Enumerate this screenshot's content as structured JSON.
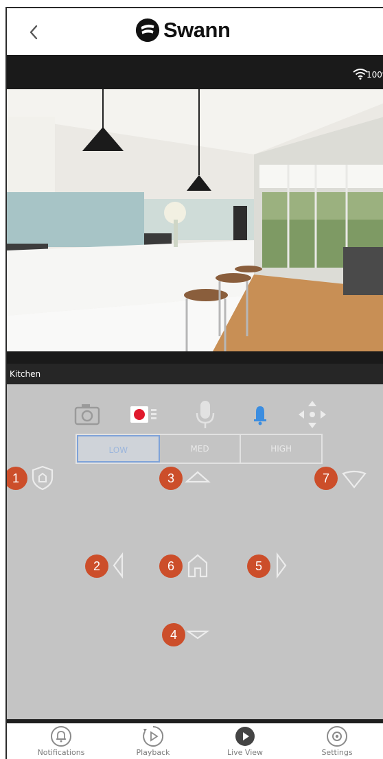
{
  "header": {
    "brand": "Swann",
    "back_icon": "chevron-left-icon"
  },
  "status": {
    "wifi_icon": "wifi-icon",
    "battery": "100%"
  },
  "camera": {
    "name": "Kitchen"
  },
  "tools": [
    {
      "name": "snapshot",
      "icon": "camera-icon"
    },
    {
      "name": "record",
      "icon": "record-icon",
      "color": "#e0192c"
    },
    {
      "name": "talk",
      "icon": "microphone-icon"
    },
    {
      "name": "siren",
      "icon": "bell-icon",
      "color": "#3b8de0"
    },
    {
      "name": "ptz",
      "icon": "move-arrows-icon"
    }
  ],
  "quality": {
    "options": [
      "LOW",
      "MED",
      "HIGH"
    ],
    "selected": "LOW"
  },
  "callouts": {
    "c1": "1",
    "c2": "2",
    "c3": "3",
    "c4": "4",
    "c5": "5",
    "c6": "6",
    "c7": "7"
  },
  "tabs": [
    {
      "label": "Notifications",
      "icon": "bell-circle-icon"
    },
    {
      "label": "Playback",
      "icon": "play-circle-outline-icon"
    },
    {
      "label": "Live View",
      "icon": "play-circle-filled-icon"
    },
    {
      "label": "Settings",
      "icon": "gear-circle-icon"
    }
  ],
  "colors": {
    "badge": "#cc4e2a",
    "control_bg": "#c4c4c4",
    "quality_active": "#7ea2d8"
  }
}
